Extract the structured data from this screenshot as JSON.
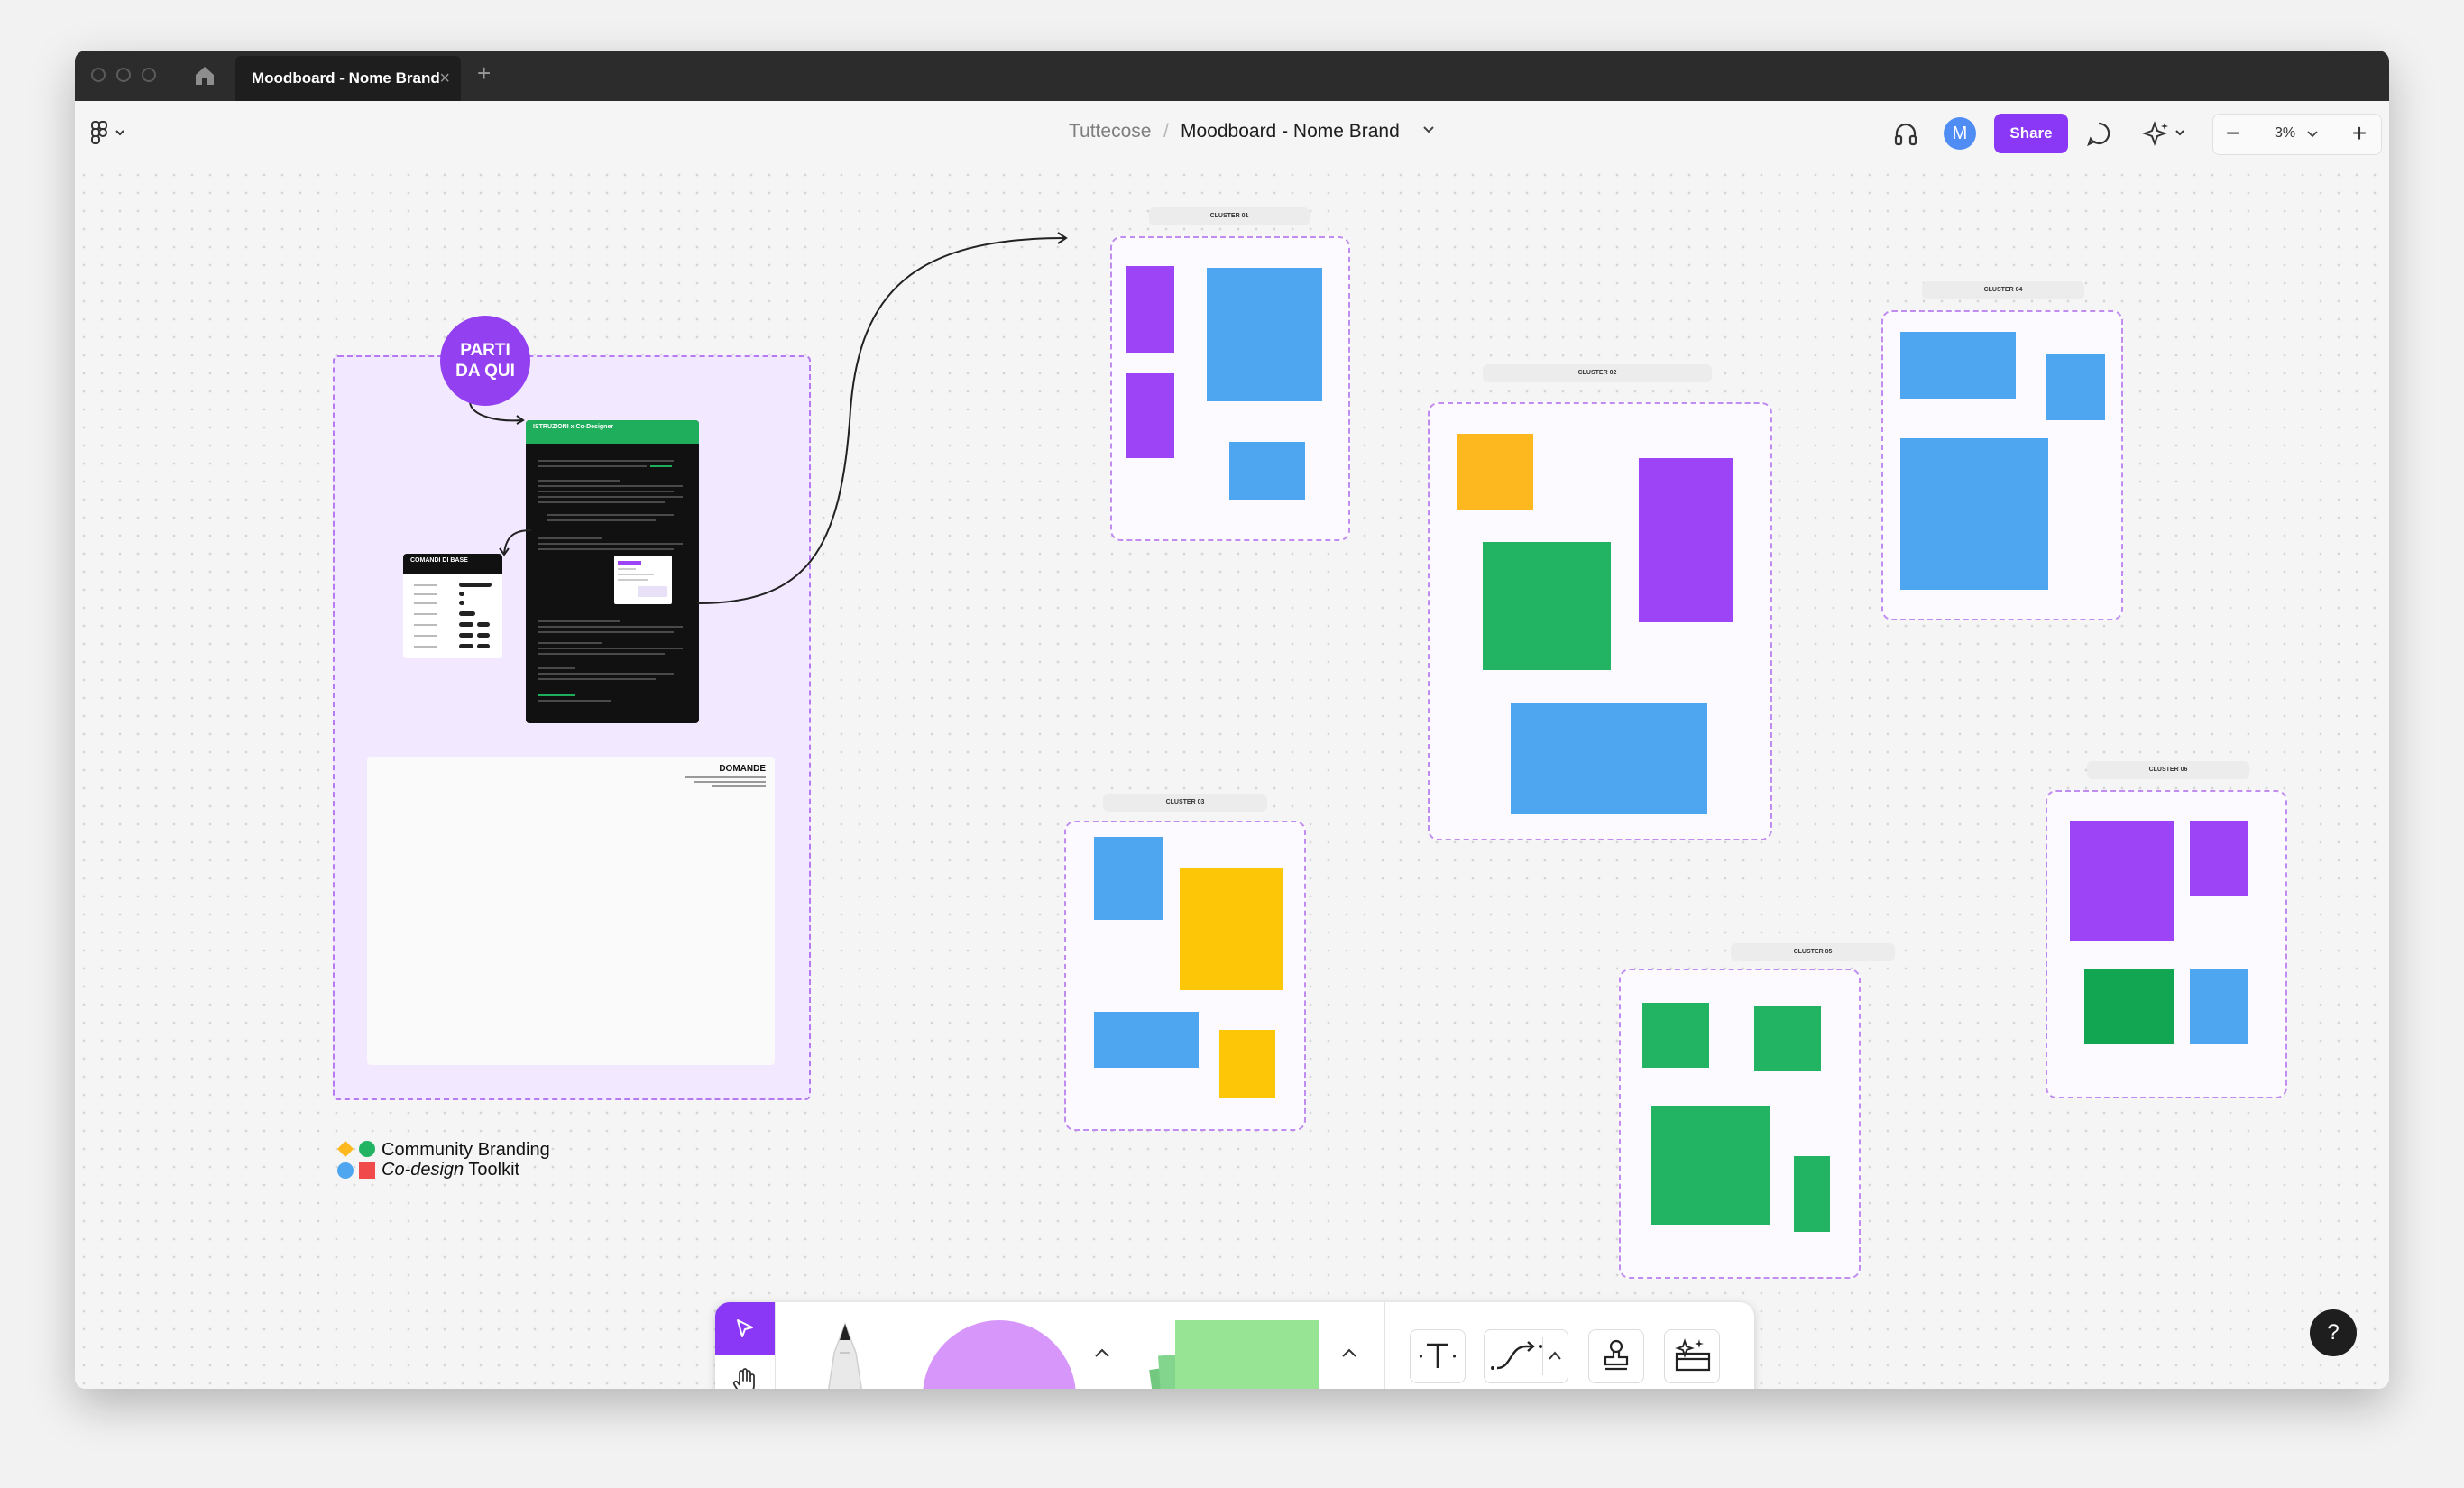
{
  "tab": {
    "title": "Moodboard - Nome Brand",
    "close": "×",
    "add": "+"
  },
  "header": {
    "team": "Tuttecose",
    "separator": "/",
    "file": "Moodboard - Nome Brand",
    "avatar_initial": "M",
    "share_label": "Share",
    "zoom": "3%",
    "zoom_minus": "−",
    "zoom_plus": "+"
  },
  "canvas": {
    "start_badge": "PARTI\nDA QUI",
    "instructions_title": "ISTRUZIONI x Co-Designer",
    "commands_title": "COMANDI DI BASE",
    "questions_title": "DOMANDE",
    "logo_line1": "Community Branding",
    "logo_line2_em": "Co-design",
    "logo_line2": "Toolkit",
    "clusters": [
      {
        "label": "CLUSTER 01"
      },
      {
        "label": "CLUSTER 02"
      },
      {
        "label": "CLUSTER 03"
      },
      {
        "label": "CLUSTER 04"
      },
      {
        "label": "CLUSTER 05"
      },
      {
        "label": "CLUSTER 06"
      }
    ]
  },
  "help": "?",
  "colors": {
    "accent": "#8a38f5",
    "sticky_purple": "#9d45f6",
    "sticky_blue": "#4da6ef",
    "sticky_orange": "#fcb81e",
    "sticky_yellow": "#fdc708",
    "sticky_green": "#22b463"
  }
}
